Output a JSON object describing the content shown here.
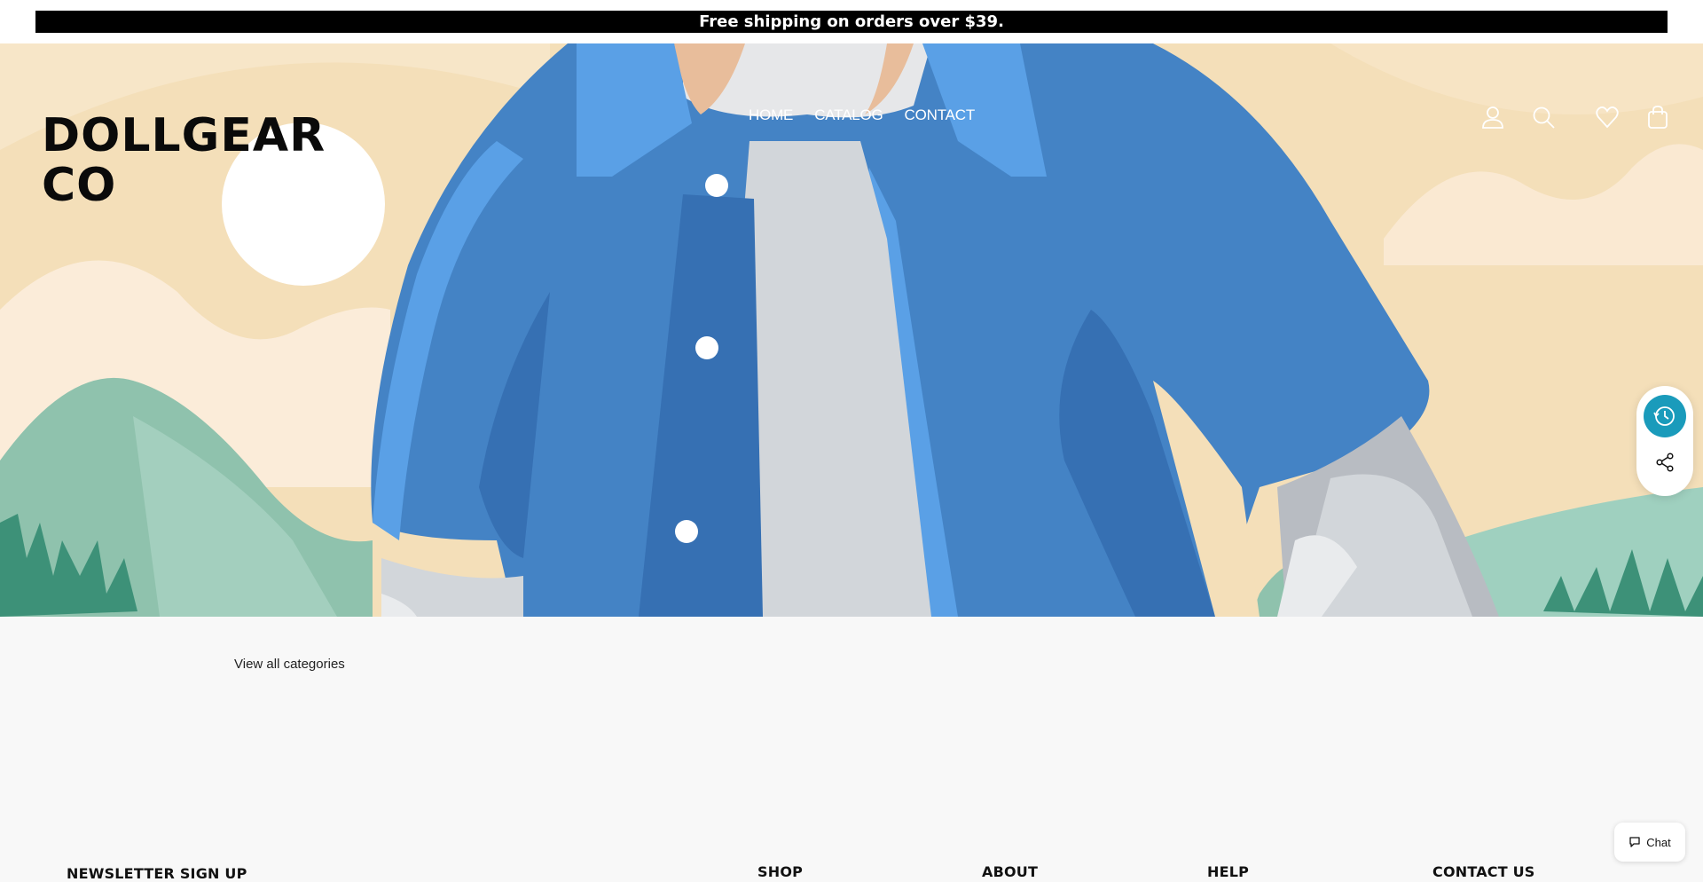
{
  "announcement": "Free shipping on orders over $39.",
  "brand": {
    "line1": "DOLLGEAR",
    "line2": "CO"
  },
  "nav": [
    "HOME",
    "CATALOG",
    "CONTACT"
  ],
  "header_icons": [
    "account-icon",
    "search-icon",
    "wishlist-icon",
    "cart-icon"
  ],
  "floating": {
    "history_icon": "history-icon",
    "share_icon": "share-icon",
    "accent": "#1a9bbb"
  },
  "categories_link": "View all categories",
  "footer": {
    "newsletter_heading": "NEWSLETTER SIGN UP",
    "columns": [
      "SHOP",
      "ABOUT",
      "HELP",
      "CONTACT US"
    ]
  },
  "chat": {
    "label": "Chat",
    "icon": "chat-icon"
  }
}
